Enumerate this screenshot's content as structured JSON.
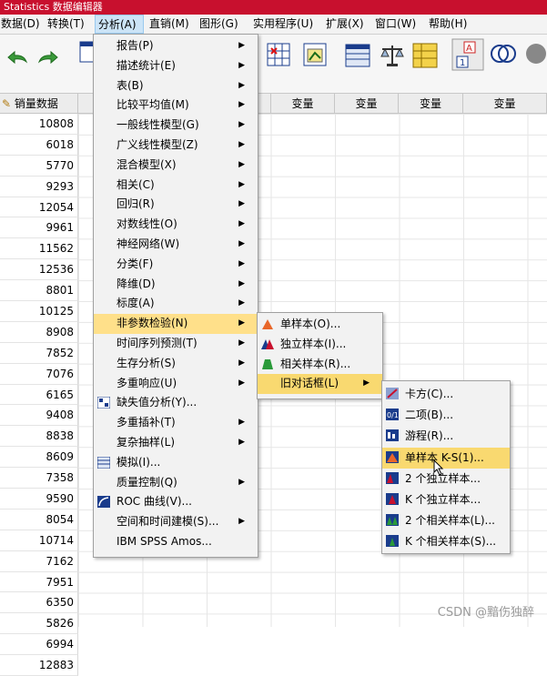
{
  "window": {
    "title": "Statistics 数据编辑器"
  },
  "menubar": [
    {
      "label": "数据(D)"
    },
    {
      "label": "转换(T)"
    },
    {
      "label": "分析(A)"
    },
    {
      "label": "直销(M)"
    },
    {
      "label": "图形(G)"
    },
    {
      "label": "实用程序(U)"
    },
    {
      "label": "扩展(X)"
    },
    {
      "label": "窗口(W)"
    },
    {
      "label": "帮助(H)"
    }
  ],
  "grid": {
    "col_header": "销量数据",
    "var_headers": [
      "变量",
      "变量",
      "变量",
      "变量"
    ],
    "sales": [
      "10808",
      "6018",
      "5770",
      "9293",
      "12054",
      "9961",
      "11562",
      "12536",
      "8801",
      "10125",
      "8908",
      "7852",
      "7076",
      "6165",
      "9408",
      "8838",
      "8609",
      "7358",
      "9590",
      "8054",
      "10714",
      "7162",
      "7951",
      "6350",
      "5826",
      "6994",
      "12883"
    ]
  },
  "analyze_menu": [
    {
      "label": "报告(P)",
      "arrow": true
    },
    {
      "label": "描述统计(E)",
      "arrow": true
    },
    {
      "label": "表(B)",
      "arrow": true
    },
    {
      "label": "比较平均值(M)",
      "arrow": true
    },
    {
      "label": "一般线性模型(G)",
      "arrow": true
    },
    {
      "label": "广义线性模型(Z)",
      "arrow": true
    },
    {
      "label": "混合模型(X)",
      "arrow": true
    },
    {
      "label": "相关(C)",
      "arrow": true
    },
    {
      "label": "回归(R)",
      "arrow": true
    },
    {
      "label": "对数线性(O)",
      "arrow": true
    },
    {
      "label": "神经网络(W)",
      "arrow": true
    },
    {
      "label": "分类(F)",
      "arrow": true
    },
    {
      "label": "降维(D)",
      "arrow": true
    },
    {
      "label": "标度(A)",
      "arrow": true
    },
    {
      "label": "非参数检验(N)",
      "arrow": true,
      "highlight": true
    },
    {
      "label": "时间序列预测(T)",
      "arrow": true
    },
    {
      "label": "生存分析(S)",
      "arrow": true
    },
    {
      "label": "多重响应(U)",
      "arrow": true
    },
    {
      "label": "缺失值分析(Y)...",
      "arrow": false,
      "icon": "missing-value-icon"
    },
    {
      "label": "多重插补(T)",
      "arrow": true
    },
    {
      "label": "复杂抽样(L)",
      "arrow": true
    },
    {
      "label": "模拟(I)...",
      "arrow": false,
      "icon": "simulation-icon"
    },
    {
      "label": "质量控制(Q)",
      "arrow": true
    },
    {
      "label": "ROC 曲线(V)...",
      "arrow": false,
      "icon": "roc-curve-icon"
    },
    {
      "label": "空间和时间建模(S)...",
      "arrow": true
    },
    {
      "label": "IBM SPSS Amos...",
      "arrow": false
    }
  ],
  "nonparam_menu": [
    {
      "label": "单样本(O)...",
      "icon": "one-sample-icon"
    },
    {
      "label": "独立样本(I)...",
      "icon": "independent-samples-icon"
    },
    {
      "label": "相关样本(R)...",
      "icon": "related-samples-icon"
    },
    {
      "label": "旧对话框(L)",
      "arrow": true,
      "highlight": true
    }
  ],
  "legacy_menu": [
    {
      "label": "卡方(C)...",
      "icon": "chi-square-icon"
    },
    {
      "label": "二项(B)...",
      "icon": "binomial-icon"
    },
    {
      "label": "游程(R)...",
      "icon": "runs-icon"
    },
    {
      "label": "单样本 K-S(1)...",
      "icon": "one-sample-ks-icon",
      "highlight": true
    },
    {
      "label": "2 个独立样本...",
      "icon": "two-independent-icon"
    },
    {
      "label": "K 个独立样本...",
      "icon": "k-independent-icon"
    },
    {
      "label": "2 个相关样本(L)...",
      "icon": "two-related-icon"
    },
    {
      "label": "K 个相关样本(S)...",
      "icon": "k-related-icon"
    }
  ],
  "watermark": "CSDN @黯伤独醉"
}
